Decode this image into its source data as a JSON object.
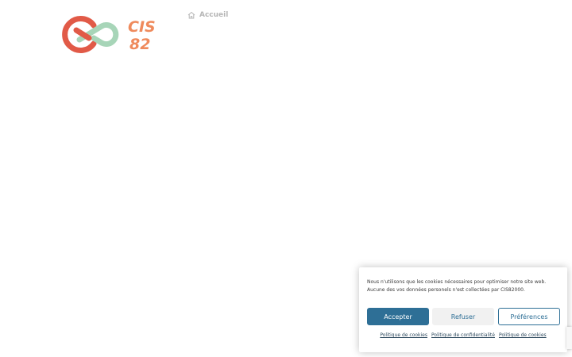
{
  "header": {
    "logo_text_line1": "CIS",
    "logo_text_line2": "82",
    "brand_colors": {
      "red": "#e15a47",
      "mint": "#a7d5b8",
      "orange": "#ef8a5c"
    }
  },
  "breadcrumb": {
    "icon": "home-icon",
    "label": "Accueil"
  },
  "cookie_banner": {
    "message": "Nous n'utilisons que les cookies nécessaires pour optimiser notre site web. Aucune des vos données personels n'est collectées par CIS82000.",
    "buttons": {
      "accept": "Accepter",
      "refuse": "Refuser",
      "preferences": "Préférences"
    },
    "links": [
      "Politique de cookies",
      "Politique de confidentialité",
      "Politique de cookies"
    ],
    "accent_color": "#2e6f96"
  }
}
